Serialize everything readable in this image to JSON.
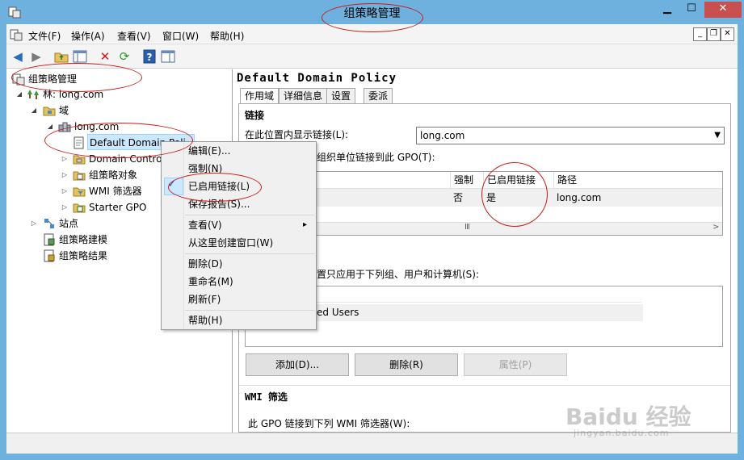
{
  "window": {
    "title": "组策略管理"
  },
  "menubar": {
    "items": [
      "文件(F)",
      "操作(A)",
      "查看(V)",
      "窗口(W)",
      "帮助(H)"
    ]
  },
  "tree": {
    "root": "组策略管理",
    "forest": "林: long.com",
    "domains": "域",
    "domain": "long.com",
    "default_policy": "Default Domain Poli",
    "dc": "Domain Contro",
    "gpo_objects": "组策略对象",
    "wmi_filters": "WMI 筛选器",
    "starter_gpo": "Starter GPO",
    "sites": "站点",
    "modeling": "组策略建模",
    "results": "组策略结果"
  },
  "context_menu": {
    "edit": "编辑(E)...",
    "enforce": "强制(N)",
    "link_enabled": "已启用链接(L)",
    "save_report": "保存报告(S)...",
    "view": "查看(V)",
    "new_window": "从这里创建窗口(W)",
    "delete": "删除(D)",
    "rename": "重命名(M)",
    "refresh": "刷新(F)",
    "help": "帮助(H)",
    "view_arrow": "▸",
    "check_mark": "✓"
  },
  "details": {
    "title": "Default Domain Policy",
    "tabs": [
      "作用域",
      "详细信息",
      "设置",
      "委派"
    ],
    "links_section": "链接",
    "show_links_label": "在此位置内显示链接(L):",
    "show_links_value": "long.com",
    "linked_label_partial": "组织单位链接到此 GPO(T):",
    "columns": {
      "enforced": "强制",
      "link_enabled": "已启用链接",
      "path": "路径"
    },
    "row": {
      "enforced": "否",
      "link_enabled": "是",
      "path": "long.com"
    },
    "scroll_thumb": "Ⅲ",
    "filter_label_partial": "置只应用于下列组、用户和计算机(S):",
    "filter_item_partial": "ed Users",
    "buttons": {
      "add": "添加(D)...",
      "remove": "删除(R)",
      "properties": "属性(P)"
    },
    "wmi_section": "WMI 筛选",
    "wmi_label": "此 GPO 链接到下列 WMI 筛选器(W):"
  },
  "watermark": {
    "brand": "Baidu 经验",
    "url": "jingyan.baidu.com"
  },
  "colors": {
    "frame": "#6fb1de",
    "annotation": "#cc1a1a",
    "selection": "#cce8ff"
  }
}
